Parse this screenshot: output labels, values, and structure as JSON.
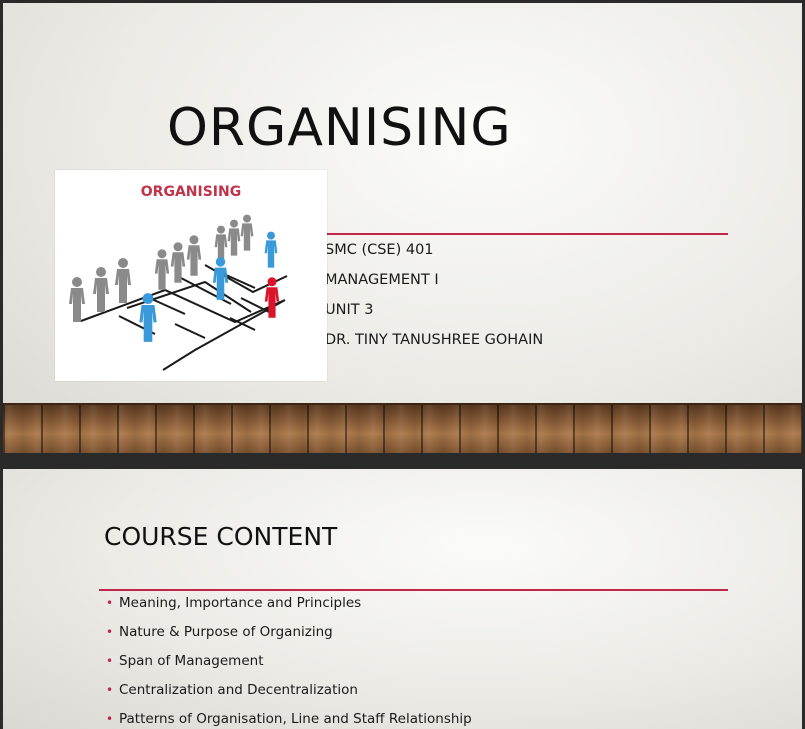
{
  "slide1": {
    "title": "ORGANISING",
    "subtitle_lines": [
      "SMC (CSE) 401",
      "MANAGEMENT I",
      "UNIT 3",
      "DR. TINY TANUSHREE GOHAIN"
    ],
    "picture": {
      "caption": "ORGANISING",
      "figure_colors": {
        "grey": "#8a8a8a",
        "blue": "#3a9ad9",
        "red": "#d9142a"
      }
    },
    "accent_color": "#c0264a"
  },
  "slide2": {
    "title": "COURSE CONTENT",
    "bullets": [
      "Meaning, Importance and Principles",
      "Nature & Purpose of Organizing",
      "Span of Management",
      "Centralization and Decentralization",
      "Patterns of Organisation, Line and Staff Relationship"
    ],
    "bullet_icon": "•"
  }
}
